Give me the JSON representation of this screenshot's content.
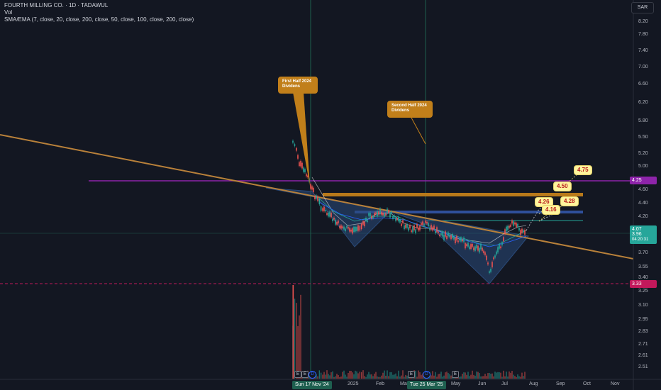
{
  "header": {
    "symbol_line": "FOURTH MILLING CO. · 1D · TADAWUL",
    "vol_label": "Vol",
    "ma_label": "SMA/EMA (7, close, 20, close, 200, close, 50, close, 100, close, 200, close)",
    "currency": "SAR"
  },
  "price_axis": {
    "ticks": [
      "8.20",
      "7.80",
      "7.40",
      "7.00",
      "6.60",
      "6.20",
      "5.80",
      "5.50",
      "5.20",
      "5.00",
      "4.80",
      "4.60",
      "4.40",
      "4.20",
      "3.70",
      "3.55",
      "3.40",
      "3.25",
      "3.10",
      "2.95",
      "2.83",
      "2.71",
      "2.61",
      "2.51"
    ],
    "labels": {
      "level_425": "4.25",
      "last_price": "4.07",
      "close_price": "3.96",
      "countdown": "04:20:31",
      "level_333": "3.33"
    }
  },
  "time_axis": {
    "labels": [
      "2025",
      "Feb",
      "Mar",
      "May",
      "Jun",
      "Jul",
      "Aug",
      "Sep",
      "Oct",
      "Nov"
    ],
    "highlight_1": "Sun 17 Nov '24",
    "highlight_2": "Tue 25 Mar '25"
  },
  "events": {
    "e_label": "E",
    "d_label": "D"
  },
  "annotations": {
    "callout_1": "First Half 2024 Dividens",
    "callout_2": "Second Half 2024 Dividens",
    "tags": {
      "t475": "4.75",
      "t450": "4.50",
      "t428": "4.28",
      "t426": "4.26",
      "t416": "4.16"
    }
  },
  "colors": {
    "background": "#131722",
    "trendline": "#b9813a",
    "resistance_orange": "#b8791a",
    "resistance_blue": "#2f4f9a",
    "level_purple": "#8e24aa",
    "level_pink": "#c2185b",
    "up_candle": "#26a69a",
    "down_candle": "#ef5350",
    "triangle_fill": "#2a4a7a"
  }
}
